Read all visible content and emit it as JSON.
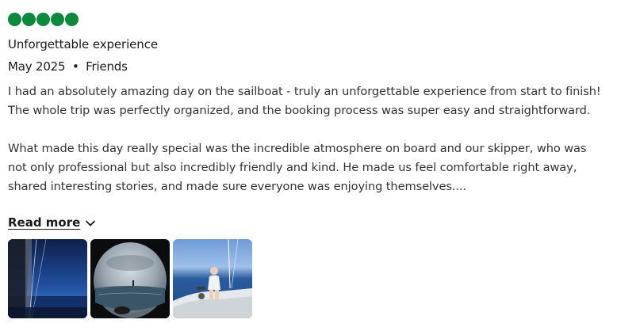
{
  "review": {
    "rating": {
      "value": 5,
      "max": 5,
      "bubble_color": "#0a8a3a"
    },
    "title": "Unforgettable experience",
    "date": "May 2025",
    "separator": "•",
    "trip_type": "Friends",
    "paragraphs": [
      "I had an absolutely amazing day on the sailboat - truly an unforgettable experience from start to finish! The whole trip was perfectly organized, and the booking process was super easy and straightforward.",
      "What made this day really special was the incredible atmosphere on board and our skipper, who was not only professional but also incredibly friendly and kind. He made us feel comfortable right away, shared interesting stories, and made sure everyone was enjoying themselves...."
    ],
    "read_more_label": "Read more",
    "read_more_icon": "chevron-down-icon",
    "photos": [
      {
        "name": "photo-sailboat-mast"
      },
      {
        "name": "photo-sea-view-fisheye"
      },
      {
        "name": "photo-person-on-deck"
      }
    ]
  }
}
